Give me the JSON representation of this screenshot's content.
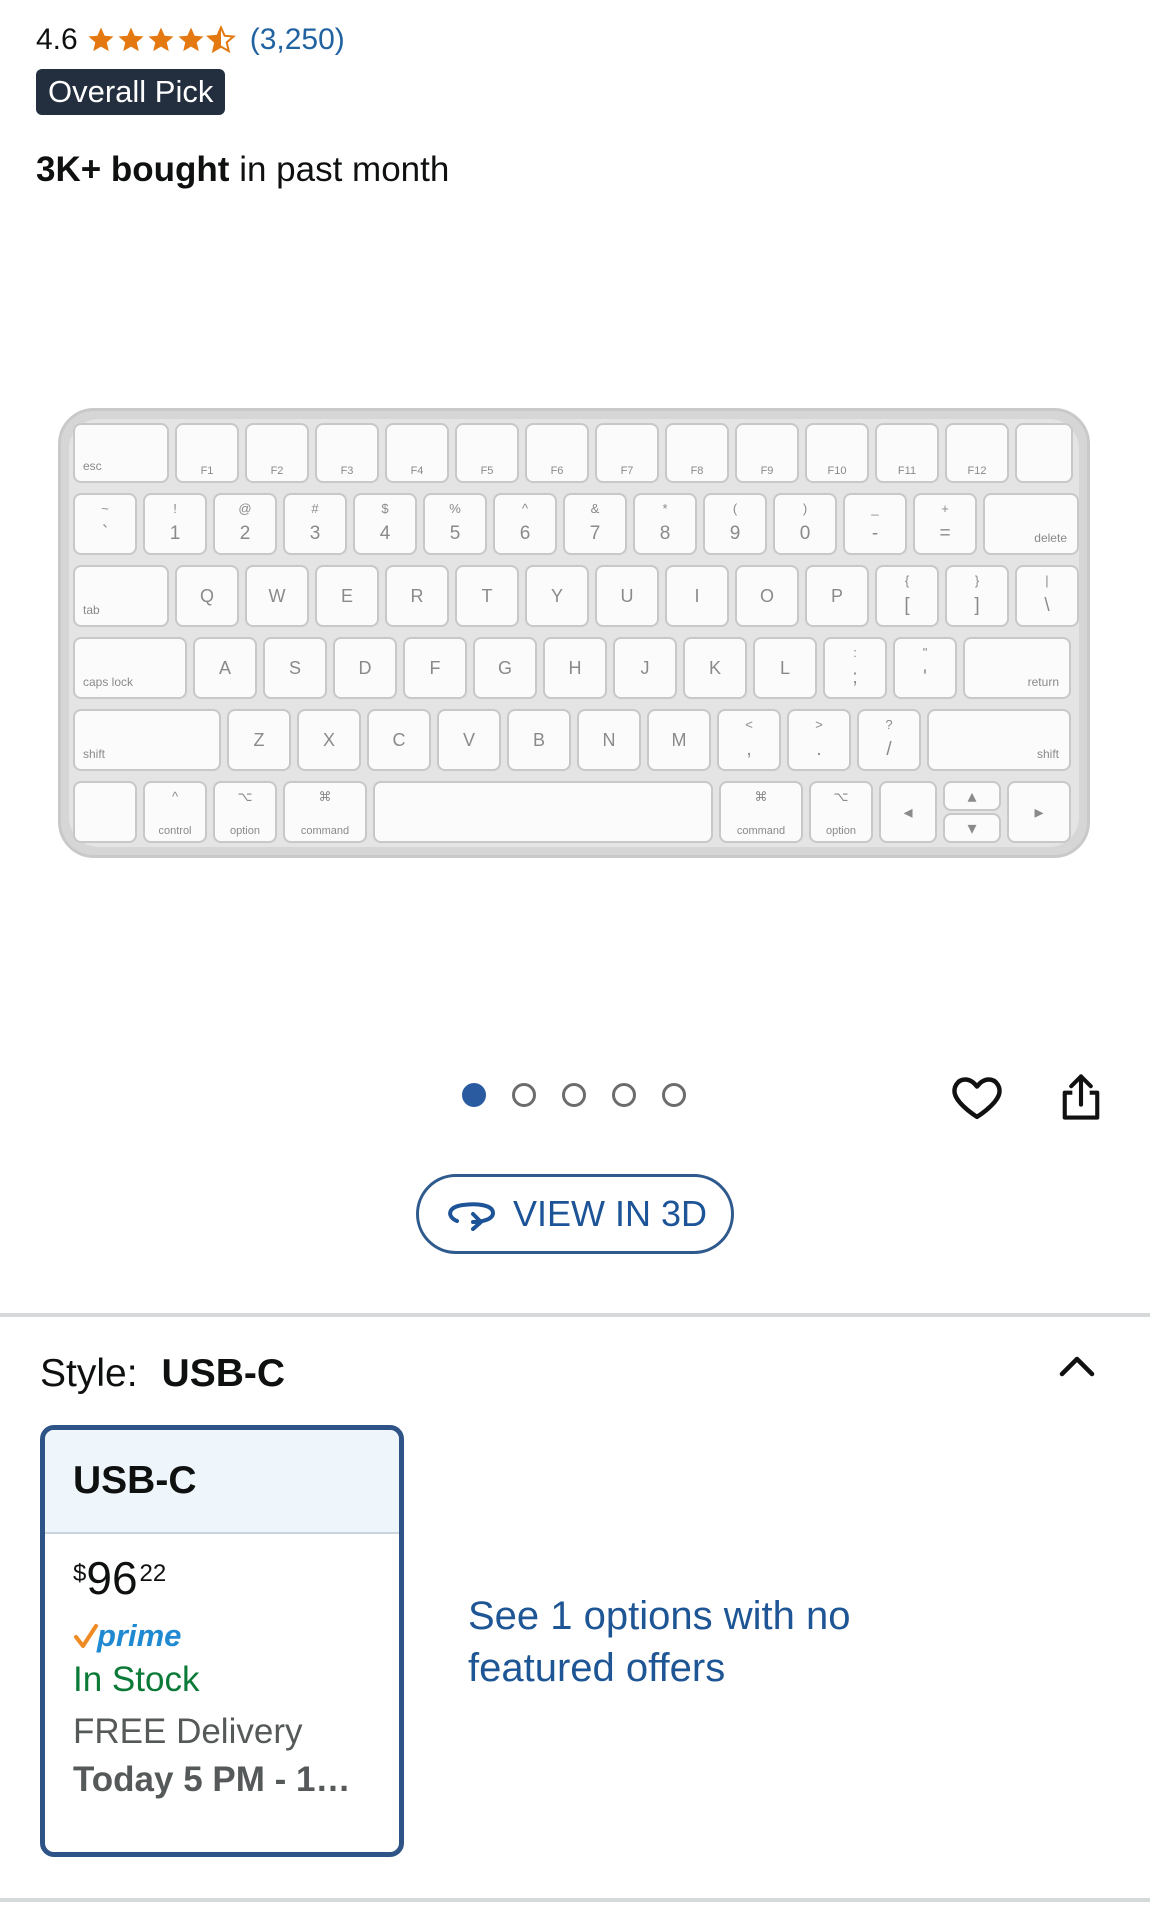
{
  "rating": {
    "value": "4.6",
    "stars": 4.6,
    "count": "(3,250)"
  },
  "badge": "Overall Pick",
  "bought": {
    "bold": "3K+ bought",
    "rest": " in past month"
  },
  "keyboard": {
    "row0": [
      "esc",
      "F1",
      "F2",
      "F3",
      "F4",
      "F5",
      "F6",
      "F7",
      "F8",
      "F9",
      "F10",
      "F11",
      "F12"
    ],
    "row1": [
      "~",
      "!",
      "@",
      "#",
      "$",
      "%",
      "^",
      "&",
      "*",
      "(",
      ")",
      "_",
      "+",
      "delete"
    ],
    "row1_bottom": [
      "`",
      "1",
      "2",
      "3",
      "4",
      "5",
      "6",
      "7",
      "8",
      "9",
      "0",
      "-",
      "="
    ],
    "row2": [
      "tab",
      "Q",
      "W",
      "E",
      "R",
      "T",
      "Y",
      "U",
      "I",
      "O",
      "P",
      "{",
      "}",
      "|"
    ],
    "row2_bottom": [
      "[",
      "]",
      "\\"
    ],
    "row3": [
      "caps lock",
      "A",
      "S",
      "D",
      "F",
      "G",
      "H",
      "J",
      "K",
      "L",
      ":",
      "\"",
      "return"
    ],
    "row3_bottom": [
      ";",
      "'"
    ],
    "row4": [
      "shift",
      "Z",
      "X",
      "C",
      "V",
      "B",
      "N",
      "M",
      "<",
      ">",
      "?",
      "shift"
    ],
    "row4_bottom": [
      ",",
      ".",
      "/"
    ],
    "row5": [
      "control",
      "option",
      "command",
      "command",
      "option"
    ],
    "row5_symbols": [
      "^",
      "⌥",
      "⌘",
      "⌘",
      "⌥"
    ]
  },
  "pagination": {
    "total": 5,
    "active": 0
  },
  "actions": {
    "view3d_label": "VIEW IN 3D",
    "heart_icon": "heart-outline-icon",
    "share_icon": "share-icon"
  },
  "style": {
    "label": "Style:",
    "value": "USB-C",
    "collapse_icon": "chevron-up-icon"
  },
  "option_card": {
    "title": "USB-C",
    "price_symbol": "$",
    "price_whole": "96",
    "price_fraction": "22",
    "prime": "prime",
    "stock": "In Stock",
    "free_delivery": "FREE Delivery",
    "delivery_time": "Today 5 PM - 1…"
  },
  "see_options": "See 1 options with no featured offers",
  "colors": {
    "link": "#2162a1",
    "star": "#e47911",
    "badge_bg": "#232f3e",
    "selected_border": "#2e5487",
    "in_stock": "#0b7a37",
    "prime": "#1f8ad1"
  }
}
